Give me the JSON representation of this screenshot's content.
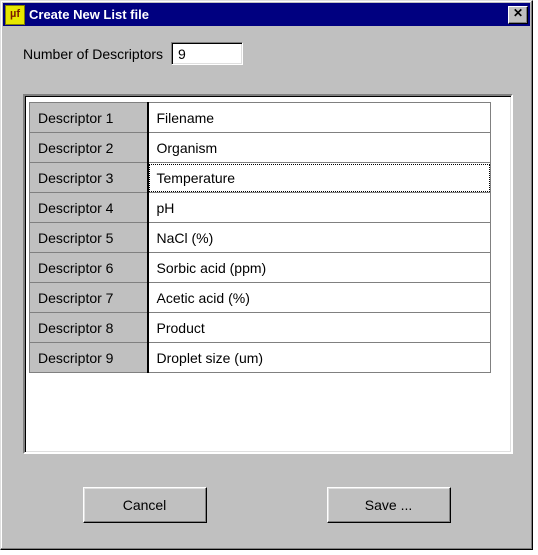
{
  "window": {
    "title": "Create New List file",
    "icon_text": "µf"
  },
  "form": {
    "num_label": "Number of Descriptors",
    "num_value": "9"
  },
  "table": {
    "rows": [
      {
        "label": "Descriptor 1",
        "value": "Filename",
        "selected": false
      },
      {
        "label": "Descriptor 2",
        "value": "Organism",
        "selected": false
      },
      {
        "label": "Descriptor 3",
        "value": "Temperature",
        "selected": true
      },
      {
        "label": "Descriptor 4",
        "value": "pH",
        "selected": false
      },
      {
        "label": "Descriptor 5",
        "value": "NaCl (%)",
        "selected": false
      },
      {
        "label": "Descriptor 6",
        "value": "Sorbic acid (ppm)",
        "selected": false
      },
      {
        "label": "Descriptor 7",
        "value": "Acetic acid (%)",
        "selected": false
      },
      {
        "label": "Descriptor 8",
        "value": "Product",
        "selected": false
      },
      {
        "label": "Descriptor 9",
        "value": "Droplet size (um)",
        "selected": false
      }
    ]
  },
  "buttons": {
    "cancel": "Cancel",
    "save": "Save ..."
  }
}
